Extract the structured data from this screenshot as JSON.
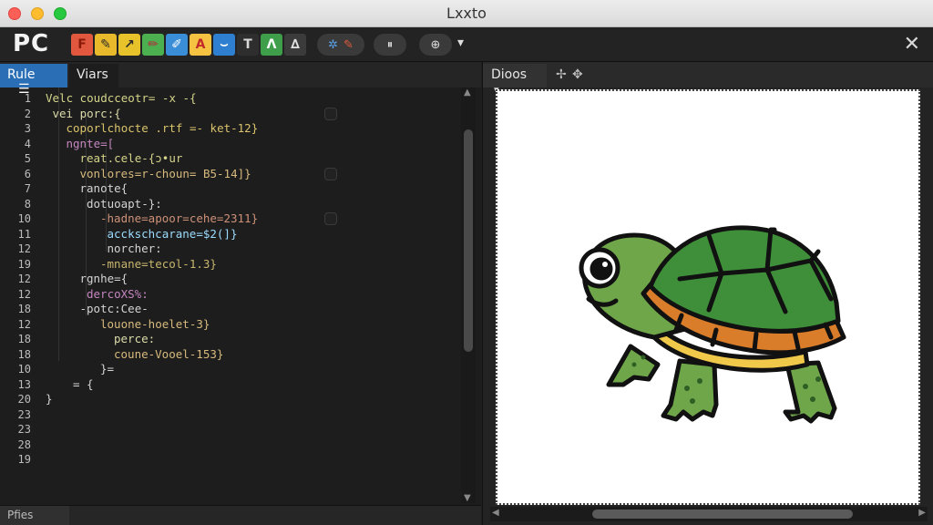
{
  "window": {
    "title": "Lxxto"
  },
  "toolbar": {
    "brand": "PC",
    "tools": [
      {
        "name": "format-f-tool",
        "glyph": "F",
        "bg": "#e2583e",
        "fg": "#8b1a0a"
      },
      {
        "name": "brush-tool",
        "glyph": "✎",
        "bg": "#e8b92a",
        "fg": "#2b2b2b"
      },
      {
        "name": "arrow-tool",
        "glyph": "↗",
        "bg": "#e8c22a",
        "fg": "#2b2b2b"
      },
      {
        "name": "pen-tool",
        "glyph": "✏",
        "bg": "#4caf50",
        "fg": "#b3283a"
      },
      {
        "name": "dropper-tool",
        "glyph": "✐",
        "bg": "#3a8ed8",
        "fg": "#ffffff"
      },
      {
        "name": "text-a-tool",
        "glyph": "A",
        "bg": "#f5c242",
        "fg": "#c22a2a"
      },
      {
        "name": "curve-tool",
        "glyph": "⌣",
        "bg": "#2f7fd0",
        "fg": "#ffffff"
      },
      {
        "name": "text-t-tool",
        "glyph": "T",
        "bg": "#2e2e2e",
        "fg": "#d8d8d8"
      },
      {
        "name": "lambda-tool",
        "glyph": "Λ",
        "bg": "#3f9e4a",
        "fg": "#ffffff"
      },
      {
        "name": "angle-tool",
        "glyph": "∆",
        "bg": "#3b3b3b",
        "fg": "#e0e0e0"
      }
    ],
    "gear_glyph": "✲",
    "wand_glyph": "✎",
    "pause_glyph": "⏸",
    "target_glyph": "⊕",
    "dropdown_glyph": "▾",
    "close_glyph": "✕"
  },
  "editor": {
    "tabs": [
      {
        "label": "Rule",
        "menu_glyph": "☰"
      },
      {
        "label": "Viars"
      }
    ],
    "line_numbers": [
      "1",
      "2",
      "3",
      "4",
      "5",
      "6",
      "7",
      "8",
      "10",
      "11",
      "12",
      "19",
      "12",
      "12",
      "18",
      "12",
      "18",
      "18",
      "10",
      "13",
      "20",
      "23",
      "23",
      "28",
      "19"
    ],
    "lines": [
      {
        "text": "Velc coudcceotr= -x -{",
        "indent": 0,
        "color": "#d4d48a"
      },
      {
        "text": "vei porc:{",
        "indent": 1,
        "color": "#dcdcaa"
      },
      {
        "text": "coporlchocte .rtf =- ket-12}",
        "indent": 3,
        "color": "#d9c36b"
      },
      {
        "text": "ngnte=[",
        "indent": 3,
        "color": "#c586c0"
      },
      {
        "text": "reat.cele-{ɔ•ur",
        "indent": 5,
        "color": "#d4d48a"
      },
      {
        "text": "vonlores=r-choun= B5-14]}",
        "indent": 5,
        "color": "#d7ba7d"
      },
      {
        "text": "ranote{",
        "indent": 5,
        "color": "#d4d4d4"
      },
      {
        "text": "dotuoapt-}:",
        "indent": 6,
        "color": "#d4d4d4"
      },
      {
        "text": "-hadne=apoor=cehe=2311}",
        "indent": 8,
        "color": "#ce9178"
      },
      {
        "text": "acckschcarane=$2(]}",
        "indent": 9,
        "color": "#9cdcfe"
      },
      {
        "text": "norcher:",
        "indent": 9,
        "color": "#d4d4d4"
      },
      {
        "text": "-mnane=tecol-1.3}",
        "indent": 8,
        "color": "#c8b66e"
      },
      {
        "text": "rgnhe={",
        "indent": 5,
        "color": "#d4d4d4"
      },
      {
        "text": "dercoXS%:",
        "indent": 6,
        "color": "#c586c0"
      },
      {
        "text": "-potc:Cee-",
        "indent": 5,
        "color": "#d4d4d4"
      },
      {
        "text": "louone-hoelet-3}",
        "indent": 8,
        "color": "#d7ba7d"
      },
      {
        "text": "perce:",
        "indent": 10,
        "color": "#dcdcaa"
      },
      {
        "text": "coune-Vooel-153}",
        "indent": 10,
        "color": "#d7ba7d"
      },
      {
        "text": "}=",
        "indent": 8,
        "color": "#d4d4d4"
      },
      {
        "text": "= {",
        "indent": 4,
        "color": "#d4d4d4"
      },
      {
        "text": "}",
        "indent": 0,
        "color": "#d4d4d4"
      }
    ],
    "status_label": "Pfies"
  },
  "preview": {
    "tab_label": "Dioos",
    "tab_dropdown": "▾",
    "tool_glyphs": [
      "✢",
      "✥"
    ]
  }
}
